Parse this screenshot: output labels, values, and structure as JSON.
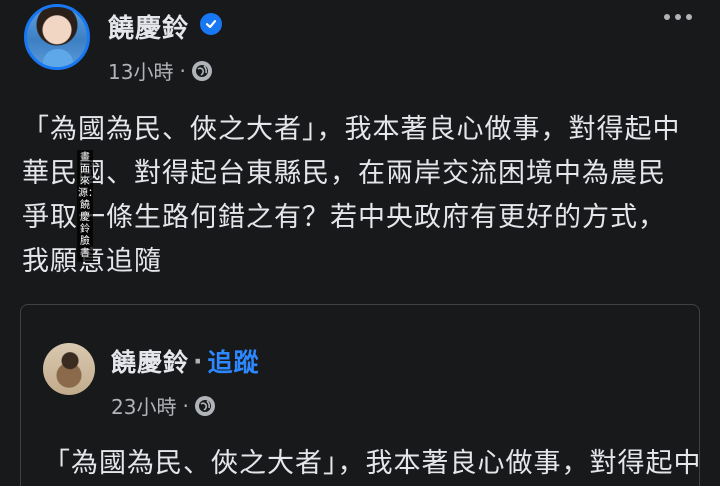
{
  "post": {
    "author_name": "饒慶鈴",
    "timestamp": "13小時",
    "separator": "·",
    "text": "「為國為民、俠之大者」，我本著良心做事，對得起中華民國、對得起台東縣民，在兩岸交流困境中為農民爭取一條生路何錯之有？若中央政府有更好的方式，我願意追隨",
    "verified_icon": "verified-check-icon",
    "privacy_icon": "globe-icon",
    "more_icon": "ellipsis-icon"
  },
  "watermark": {
    "text": "畫面來源：饒慶鈴臉書"
  },
  "shared_post": {
    "author_name": "饒慶鈴",
    "separator": "·",
    "follow_label": "追蹤",
    "timestamp": "23小時",
    "text": "「為國為民、俠之大者」，我本著良心做事，對得起中",
    "privacy_icon": "globe-icon"
  },
  "colors": {
    "background": "#18191a",
    "text": "#e4e6eb",
    "secondary_text": "#b0b3b8",
    "accent": "#1877f2",
    "link": "#2d88ff"
  }
}
